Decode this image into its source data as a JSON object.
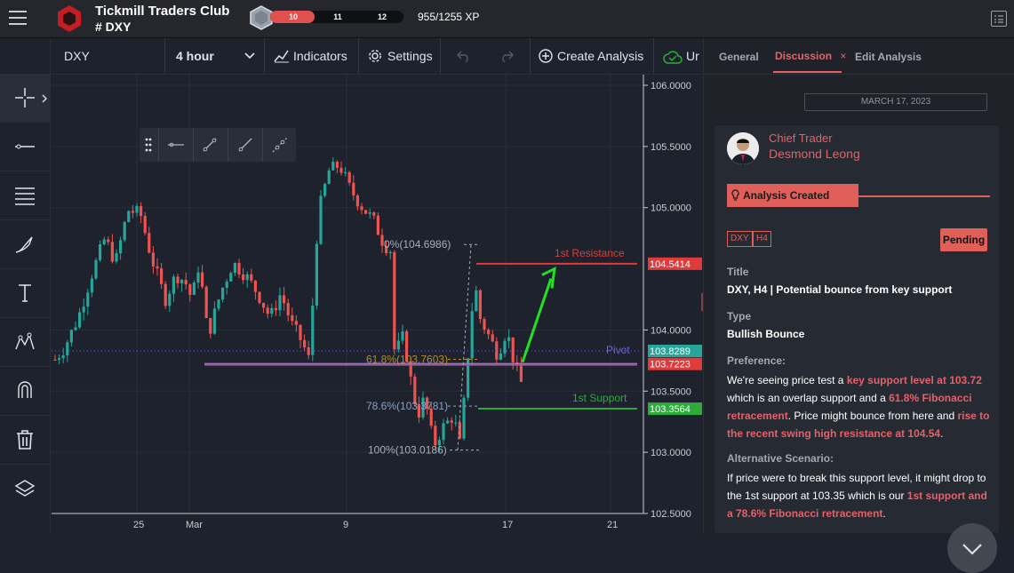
{
  "header": {
    "club_name": "Tickmill Traders Club",
    "symbol_tag": "# DXY",
    "xp_levels": [
      "10",
      "11",
      "12"
    ],
    "xp_progress": 0.33,
    "xp_text": "955/1255 XP"
  },
  "toolbar": {
    "symbol": "DXY",
    "interval": "4 hour",
    "indicators": "Indicators",
    "settings": "Settings",
    "create_analysis": "Create Analysis",
    "upload_partial": "Ur"
  },
  "chart_data": {
    "type": "candlestick",
    "x_ticks": [
      "25",
      "Mar",
      "9",
      "17",
      "21"
    ],
    "y_ticks": [
      "106.0000",
      "105.5000",
      "105.0000",
      "104.0000",
      "103.5000",
      "103.0000",
      "102.5000"
    ],
    "ylim": [
      102.5,
      106.0
    ],
    "price_labels": [
      {
        "text": "104.5414",
        "value": 104.5414,
        "color": "#e03b3b"
      },
      {
        "text": "103.8289",
        "value": 103.8289,
        "color": "#26a69a"
      },
      {
        "text": "103.7223",
        "value": 103.7223,
        "color": "#e03b3b"
      },
      {
        "text": "103.3564",
        "value": 103.3564,
        "color": "#2eaa3c"
      }
    ],
    "levels": [
      {
        "label": "1st Resistance",
        "value": 104.5414,
        "color": "#e03b3b"
      },
      {
        "label": "Pivot",
        "value": 103.8289,
        "color": "#6b63d6"
      },
      {
        "label": "1st Support",
        "value": 103.3564,
        "color": "#2eaa3c"
      }
    ],
    "fibonacci": [
      {
        "label": "0%(104.6986)",
        "value": 104.6986,
        "color": "#a9adb5"
      },
      {
        "label": "61.8%(103.7603)",
        "value": 103.7603,
        "color": "#b38a35"
      },
      {
        "label": "78.6%(103.3781)",
        "value": 103.3781,
        "color": "#8aa0bd"
      },
      {
        "label": "100%(103.0186)",
        "value": 103.0186,
        "color": "#a9adb5"
      }
    ],
    "support_line": 103.7223
  },
  "panel": {
    "tabs": [
      "General",
      "Discussion",
      "Edit Analysis"
    ],
    "active_tab_close": "×",
    "date": "MARCH 17, 2023",
    "author_role": "Chief Trader",
    "author_name": "Desmond Leong",
    "flag": "Analysis Created",
    "tags": [
      "DXY",
      "H4"
    ],
    "status": "Pending",
    "title_label": "Title",
    "title_value": "DXY, H4 | Potential bounce from key support",
    "type_label": "Type",
    "type_value": "Bullish Bounce",
    "preference_label": "Preference:",
    "pref": {
      "a": "We're seeing price test a ",
      "b": "key support level at 103.72",
      "c": " which is an overlap support and a ",
      "d": "61.8% Fibonacci retracement",
      "e": ". Price might bounce from here and ",
      "f": "rise to the recent swing high resistance at 104.54",
      "g": "."
    },
    "alt_label": "Alternative Scenario:",
    "alt": {
      "a": "If price were to break this support level, it might drop to the 1st support at 103.35 which is our ",
      "b": "1st support and a 78.6% Fibonacci retracement",
      "c": "."
    }
  }
}
